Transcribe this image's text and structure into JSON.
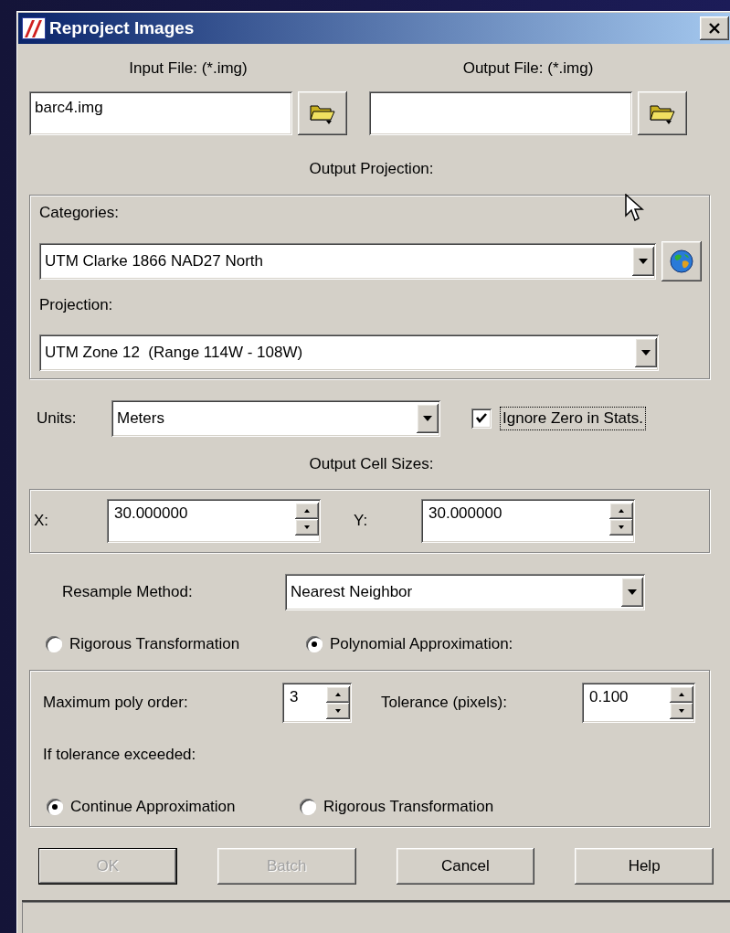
{
  "window": {
    "title": "Reproject Images"
  },
  "input_file": {
    "label": "Input File: (*.img)",
    "value": "barc4.img"
  },
  "output_file": {
    "label": "Output File: (*.img)"
  },
  "output_projection": {
    "heading": "Output Projection:",
    "categories": {
      "label": "Categories:",
      "value": "UTM Clarke 1866 NAD27 North"
    },
    "projection": {
      "label": "Projection:",
      "value": "UTM Zone 12  (Range 114W - 108W)"
    }
  },
  "units": {
    "label": "Units:",
    "value": "Meters"
  },
  "ignore_zero": {
    "label": "Ignore Zero in Stats.",
    "checked": true
  },
  "cell_sizes": {
    "heading": "Output Cell Sizes:",
    "x": {
      "label": "X:",
      "value": "30.000000"
    },
    "y": {
      "label": "Y:",
      "value": "30.000000"
    }
  },
  "resample": {
    "label": "Resample Method:",
    "value": "Nearest Neighbor"
  },
  "methods": [
    {
      "label": "Rigorous Transformation",
      "selected": false
    },
    {
      "label": "Polynomial Approximation:",
      "selected": true
    }
  ],
  "polynomial": {
    "max_order": {
      "label": "Maximum poly order:",
      "value": "3"
    },
    "tolerance": {
      "label": "Tolerance (pixels):",
      "value": "0.100"
    },
    "exceeded_label": "If tolerance exceeded:",
    "on_exceed": [
      {
        "label": "Continue Approximation",
        "selected": true
      },
      {
        "label": "Rigorous Transformation",
        "selected": false
      }
    ]
  },
  "buttons": [
    {
      "label": "OK",
      "disabled": true
    },
    {
      "label": "Batch",
      "disabled": true
    },
    {
      "label": "Cancel",
      "disabled": false
    },
    {
      "label": "Help",
      "disabled": false
    }
  ]
}
